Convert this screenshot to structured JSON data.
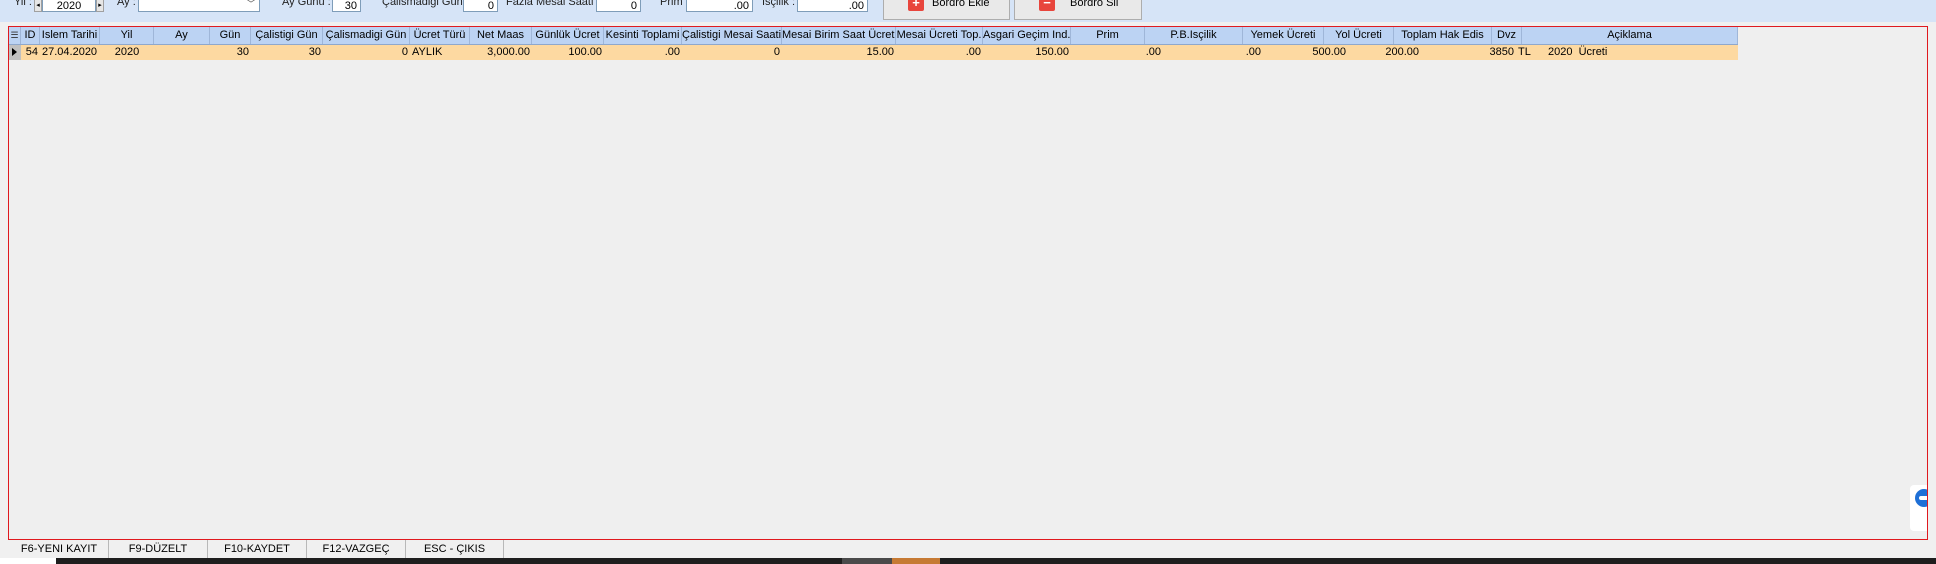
{
  "toolbar": {
    "yil_label": "Yil :",
    "yil_value": "2020",
    "ay_label": "Ay :",
    "ay_value": "",
    "ay_gunu_label": "Ay Günü :",
    "ay_gunu_value": "30",
    "calismadigi_gun_label": "Çalismadigi Gün :",
    "calismadigi_gun_value": "0",
    "fazla_mesai_label": "Fazla Mesai Saati :",
    "fazla_mesai_value": "0",
    "prim_label": "Prim :",
    "prim_value": ".00",
    "iscilik_label": "Isçilik :",
    "iscilik_value": ".00",
    "bordro_ekle_label": "Bordro Ekle",
    "bordro_sil_label": "Bordro Sil"
  },
  "grid": {
    "columns": [
      "ID",
      "Islem Tarihi",
      "Yil",
      "Ay",
      "Gün",
      "Çalistigi Gün",
      "Çalismadigi Gün",
      "Ücret Türü",
      "Net Maas",
      "Günlük Ücret",
      "Kesinti Toplami",
      "Çalistigi Mesai Saati",
      "Mesai Birim Saat Ücreti",
      "Mesai Ücreti Top.",
      "Asgari Geçim Ind.",
      "Prim",
      "P.B.Isçilik",
      "Yemek Ücreti",
      "Yol Ücreti",
      "Toplam Hak Edis",
      "Dvz",
      "Açiklama"
    ],
    "rows": [
      {
        "id": "54",
        "islem_tarihi": "27.04.2020",
        "yil": "2020",
        "ay": "",
        "gun": "30",
        "calistigi_gun": "30",
        "calismadigi_gun": "0",
        "ucret_turu": "AYLIK",
        "net_maas": "3,000.00",
        "gunluk_ucret": "100.00",
        "kesinti_toplami": ".00",
        "calistigi_mesai_saati": "0",
        "mesai_birim_saat_ucreti": "15.00",
        "mesai_ucreti_top": ".00",
        "asgari_gecim_ind": "150.00",
        "prim": ".00",
        "pb_iscilik": ".00",
        "yemek_ucreti": "500.00",
        "yol_ucreti": "200.00",
        "toplam_hak_edis": "3850",
        "dvz": "TL",
        "aciklama": "2020  Ücreti"
      }
    ]
  },
  "statusbar": {
    "keys": [
      "F6-YENI KAYIT",
      "F9-DÜZELT",
      "F10-KAYDET",
      "F12-VAZGEÇ",
      "ESC - ÇIKIS"
    ]
  },
  "icons": {
    "bordro_ekle_icon": "plus-icon",
    "bordro_sil_icon": "minus-icon",
    "row_indicator_icon": "triangle-right-icon",
    "side_tab_icon": "teamviewer-icon"
  },
  "colors": {
    "toolbar_bg": "#d6e4f7",
    "header_bg": "#bcd3f3",
    "selected_row_bg": "#fdd9a1",
    "grid_border": "#e0191e",
    "button_icon": "#e8453c"
  }
}
